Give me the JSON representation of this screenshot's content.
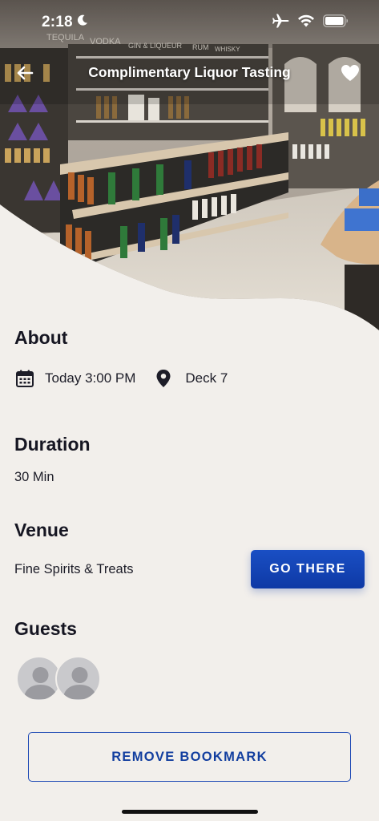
{
  "status_bar": {
    "time": "2:18",
    "moon_icon": "moon-icon",
    "airplane_icon": "airplane-icon",
    "wifi_icon": "wifi-icon",
    "battery_icon": "battery-icon"
  },
  "header": {
    "title": "Complimentary Liquor Tasting",
    "back_icon": "back-arrow-icon",
    "favorite_icon": "heart-icon"
  },
  "hero": {
    "sign_labels": [
      "TEQUILA",
      "VODKA",
      "GIN & LIQUEUR",
      "RUM",
      "WHISKY"
    ]
  },
  "about": {
    "heading": "About",
    "date_icon": "calendar-icon",
    "date_time": "Today 3:00 PM",
    "location_icon": "location-pin-icon",
    "location": "Deck 7"
  },
  "duration": {
    "heading": "Duration",
    "value": "30 Min"
  },
  "venue": {
    "heading": "Venue",
    "name": "Fine Spirits & Treats",
    "go_there_label": "GO THERE"
  },
  "guests": {
    "heading": "Guests",
    "count": 2
  },
  "actions": {
    "remove_bookmark_label": "REMOVE BOOKMARK"
  },
  "colors": {
    "background": "#f2efeb",
    "primary": "#0e39a5",
    "text": "#161622"
  }
}
